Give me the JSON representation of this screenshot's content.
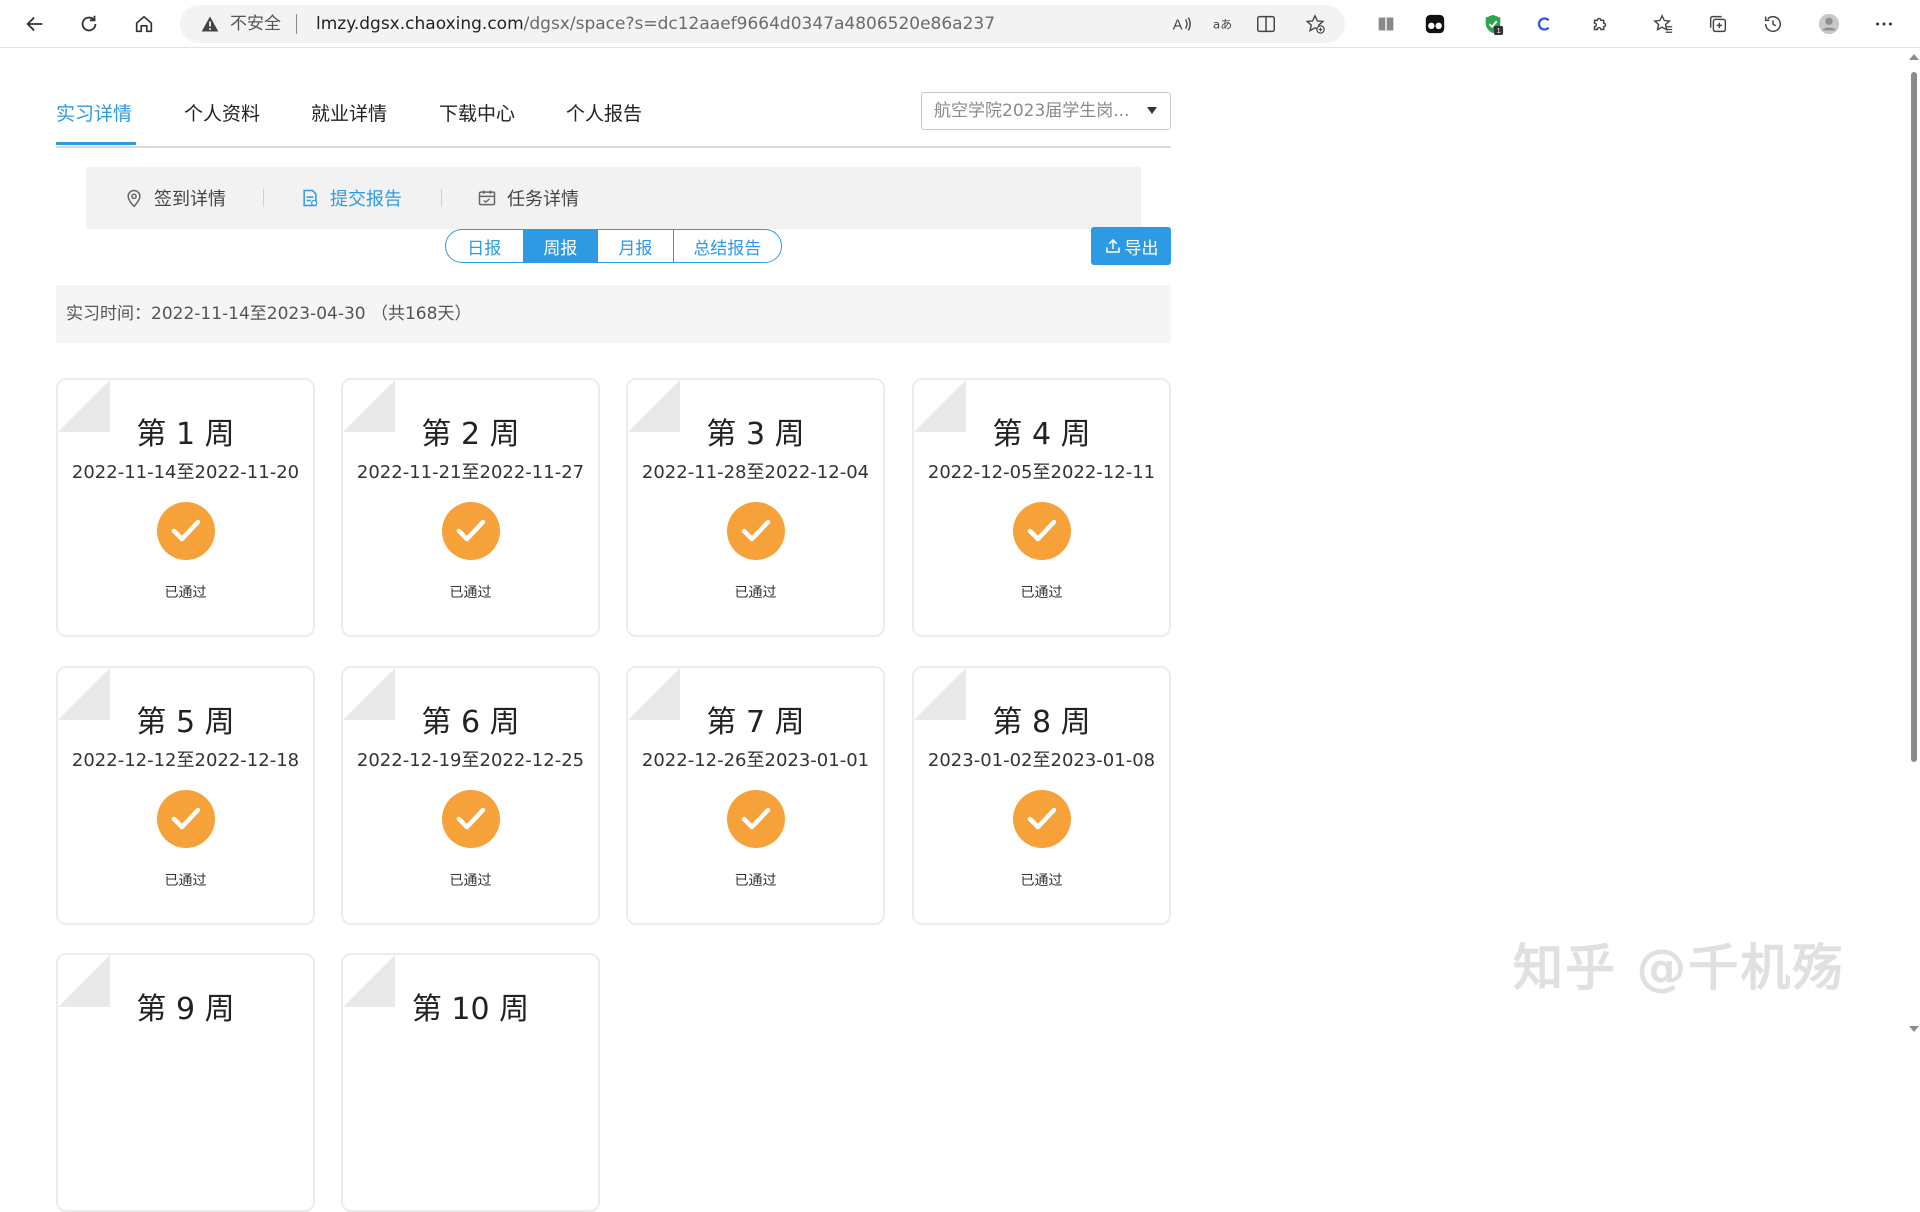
{
  "browser": {
    "security_label": "不安全",
    "url_host": "lmzy.dgsx.chaoxing.com",
    "url_path": "/dgsx/space?s=dc12aaef9664d0347a4806520e86a237",
    "extension_badge": "1",
    "read_aloud_label": "A",
    "translate_label": "aあ"
  },
  "nav": {
    "tabs": [
      "实习详情",
      "个人资料",
      "就业详情",
      "下载中心",
      "个人报告"
    ],
    "active_index": 0
  },
  "batch_select": {
    "value": "航空学院2023届学生岗..."
  },
  "sub_nav": {
    "items": [
      "签到详情",
      "提交报告",
      "任务详情"
    ],
    "active_index": 1
  },
  "report_tabs": {
    "items": [
      "日报",
      "周报",
      "月报",
      "总结报告"
    ],
    "active_index": 1
  },
  "export_button": "导出",
  "period": {
    "text": "实习时间：2022-11-14至2023-04-30  （共168天）"
  },
  "weeks": [
    {
      "title": "第 1 周",
      "range": "2022-11-14至2022-11-20",
      "status": "已通过"
    },
    {
      "title": "第 2 周",
      "range": "2022-11-21至2022-11-27",
      "status": "已通过"
    },
    {
      "title": "第 3 周",
      "range": "2022-11-28至2022-12-04",
      "status": "已通过"
    },
    {
      "title": "第 4 周",
      "range": "2022-12-05至2022-12-11",
      "status": "已通过"
    },
    {
      "title": "第 5 周",
      "range": "2022-12-12至2022-12-18",
      "status": "已通过"
    },
    {
      "title": "第 6 周",
      "range": "2022-12-19至2022-12-25",
      "status": "已通过"
    },
    {
      "title": "第 7 周",
      "range": "2022-12-26至2023-01-01",
      "status": "已通过"
    },
    {
      "title": "第 8 周",
      "range": "2023-01-02至2023-01-08",
      "status": "已通过"
    },
    {
      "title": "第 9 周"
    },
    {
      "title": "第 10 周"
    }
  ],
  "watermark": "知乎 @千机殇",
  "colors": {
    "accent": "#2d9ae3",
    "status_approved": "#f7a13a"
  }
}
